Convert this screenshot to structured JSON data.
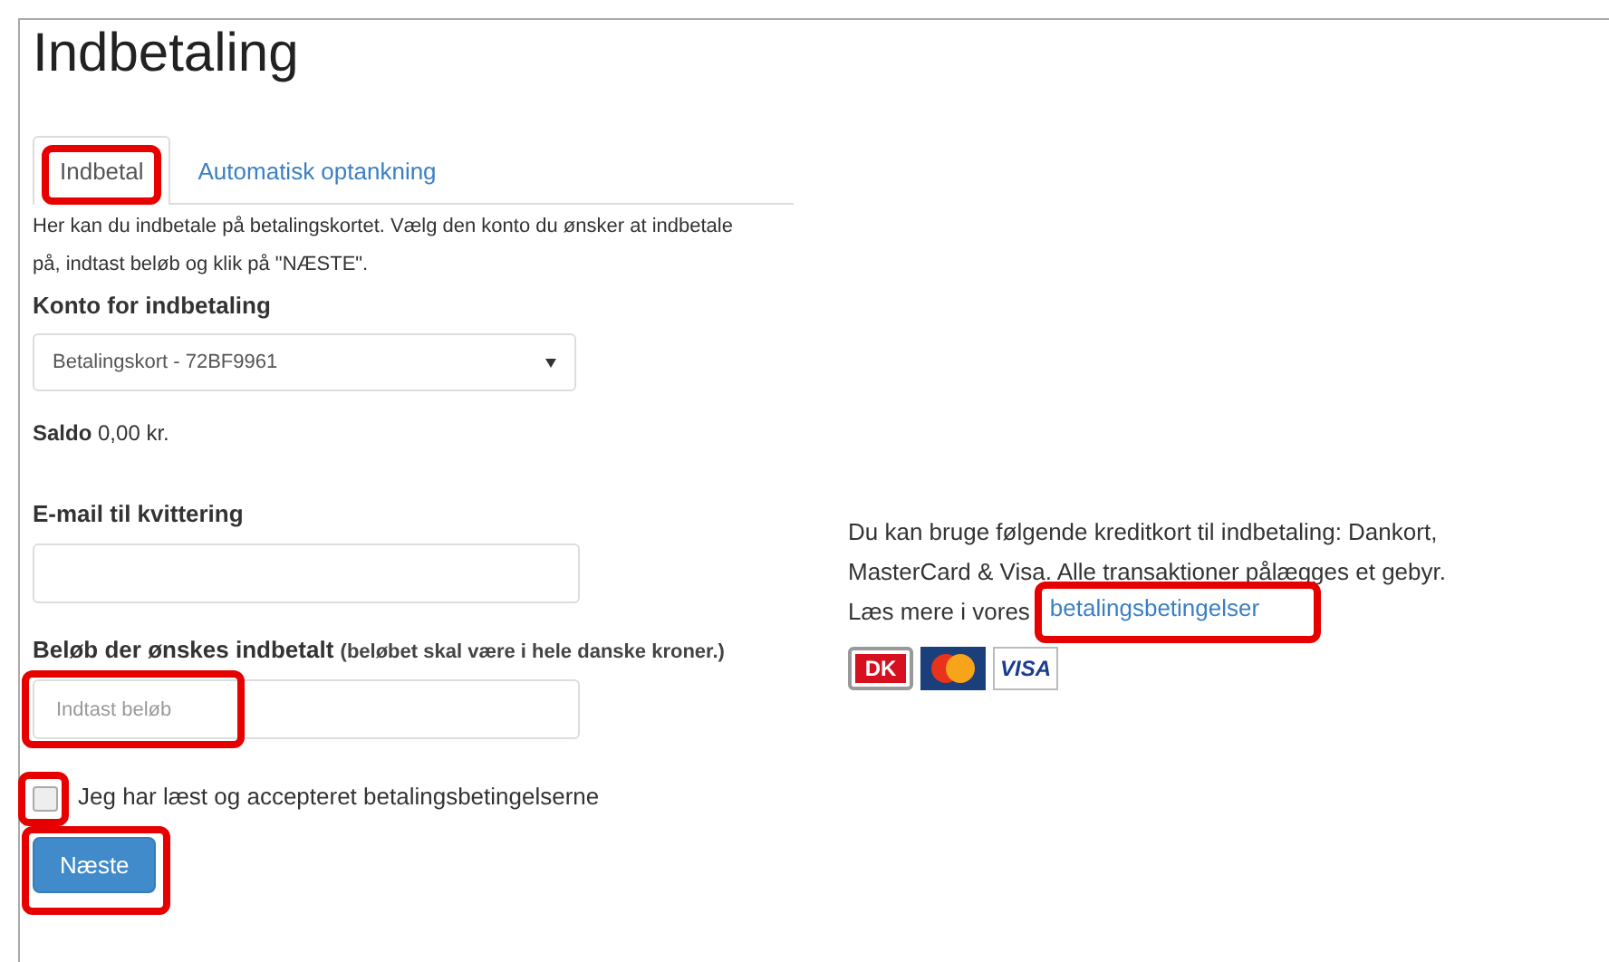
{
  "page": {
    "title": "Indbetaling"
  },
  "tabs": [
    {
      "label": "Indbetal",
      "selected": true,
      "highlighted": true
    },
    {
      "label": "Automatisk optankning",
      "selected": false,
      "highlighted": false
    }
  ],
  "intro": "Her kan du indbetale på betalingskortet. Vælg den konto du ønsker at indbetale på, indtast beløb og klik på \"NÆSTE\".",
  "account": {
    "label": "Konto for indbetaling",
    "value": "Betalingskort - 72BF9961"
  },
  "balance": {
    "label": "Saldo",
    "value": "0,00 kr."
  },
  "email": {
    "label": "E-mail til kvittering"
  },
  "amount": {
    "label": "Beløb der ønskes indbetalt",
    "note": "(beløbet skal være i hele danske kroner.)",
    "placeholder": "Indtast beløb",
    "highlighted": true
  },
  "terms": {
    "label": "Jeg har læst og accepteret betalingsbetingelserne",
    "checked": false,
    "highlighted": true
  },
  "next_button": {
    "label": "Næste",
    "highlighted": true
  },
  "info": {
    "text": "Du kan bruge følgende kreditkort til indbetaling: Dankort, MasterCard & Visa. Alle transaktioner pålægges et gebyr.",
    "read_more": "Læs mere i vores",
    "link": "betalingsbetingelser",
    "link_highlighted": true
  },
  "cards": [
    {
      "kind": "dankort",
      "label": "DK"
    },
    {
      "kind": "mastercard"
    },
    {
      "kind": "visa",
      "label": "VISA"
    }
  ]
}
